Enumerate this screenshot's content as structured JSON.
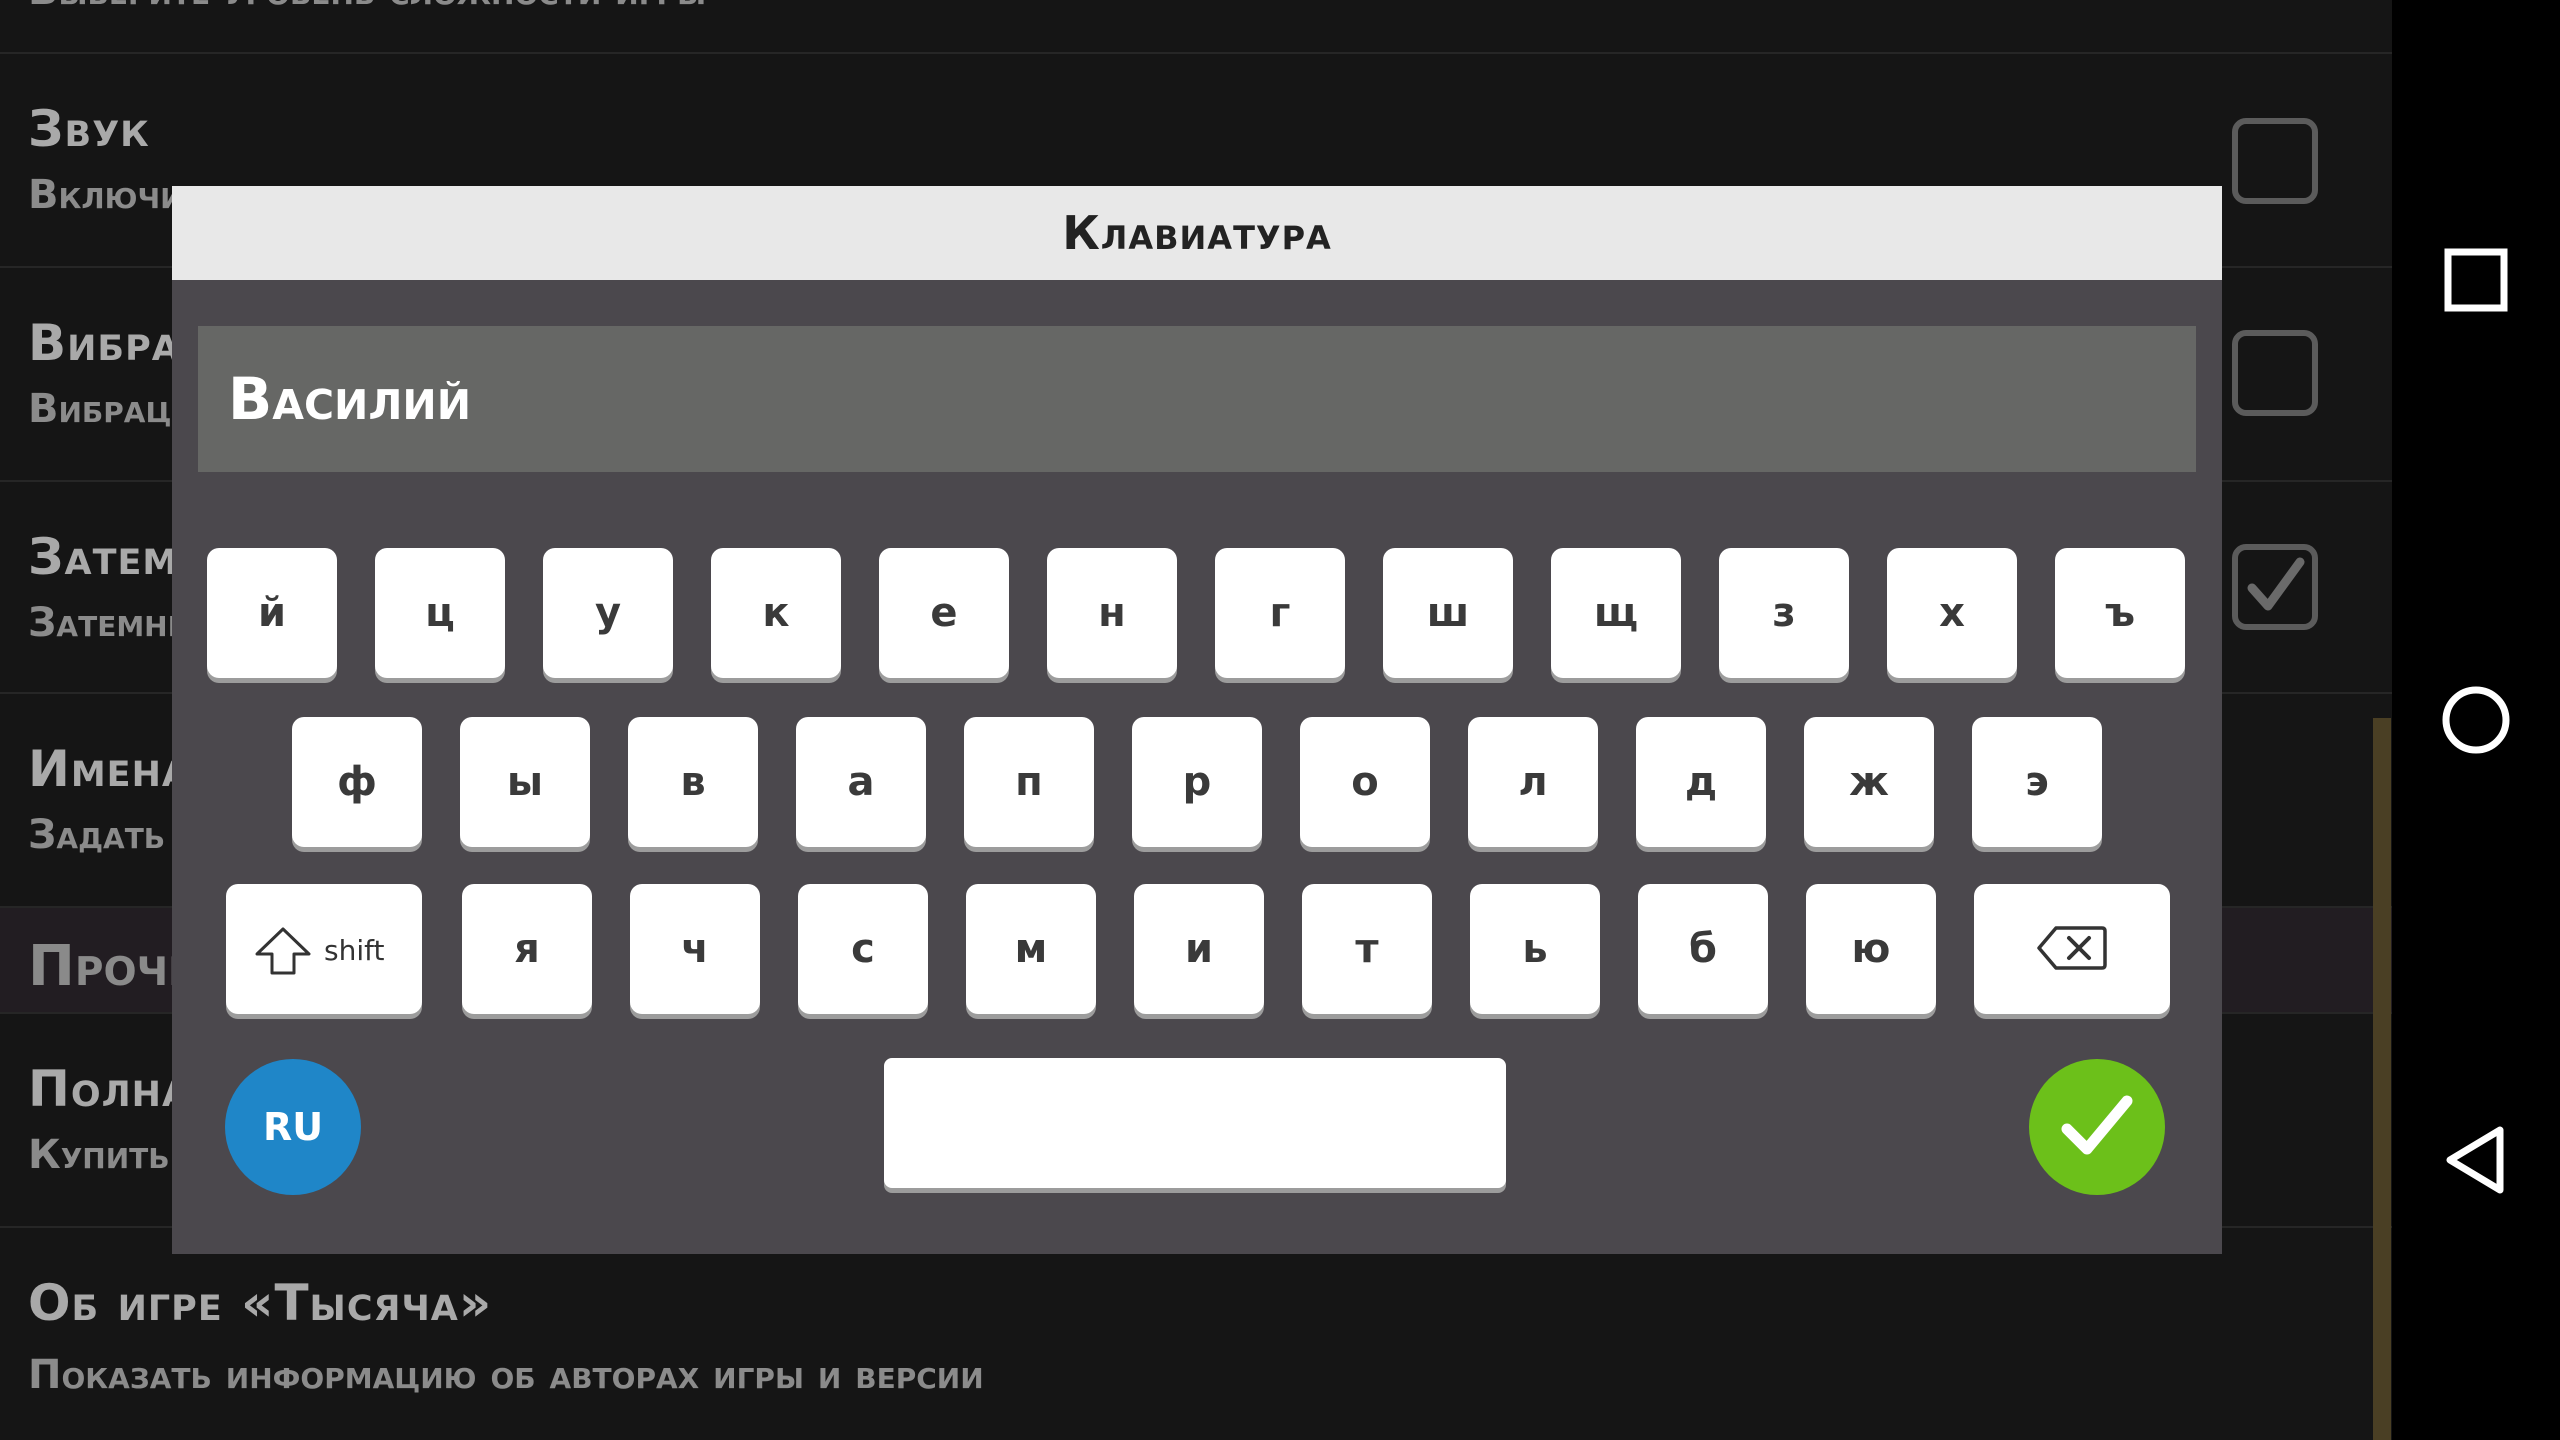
{
  "settings": {
    "top_partial_text": "Выберите уровень сложности игры",
    "rows": [
      {
        "title": "Звук",
        "subtitle": "Включить",
        "checked": false
      },
      {
        "title": "Вибрация",
        "subtitle": "Вибрация",
        "checked": false
      },
      {
        "title": "Затемнение",
        "subtitle": "Затемнить",
        "checked": true
      },
      {
        "title": "Имена",
        "subtitle": "Задать"
      }
    ],
    "section": "Прочее",
    "rows2": [
      {
        "title": "Полная версия",
        "subtitle": "Купить"
      },
      {
        "title": "Об игре «Тысяча»",
        "subtitle": "Показать информацию об авторах игры и версии"
      }
    ]
  },
  "dialog": {
    "title": "Клавиатура",
    "input_value": "Василий"
  },
  "keyboard": {
    "row1": [
      "й",
      "ц",
      "у",
      "к",
      "е",
      "н",
      "г",
      "ш",
      "щ",
      "з",
      "х",
      "ъ"
    ],
    "row2": [
      "ф",
      "ы",
      "в",
      "а",
      "п",
      "р",
      "о",
      "л",
      "д",
      "ж",
      "э"
    ],
    "row3": [
      "я",
      "ч",
      "с",
      "м",
      "и",
      "т",
      "ь",
      "б",
      "ю"
    ],
    "shift_label": "shift",
    "lang_label": "RU"
  },
  "colors": {
    "lang_button": "#1f86c8",
    "done_button": "#6cc01a",
    "dialog_bg": "#4b484d"
  },
  "icons": {
    "shift": "shift-arrow-icon",
    "backspace": "backspace-icon",
    "done": "checkmark-icon",
    "nav_recent": "square-icon",
    "nav_home": "circle-icon",
    "nav_back": "triangle-back-icon"
  }
}
